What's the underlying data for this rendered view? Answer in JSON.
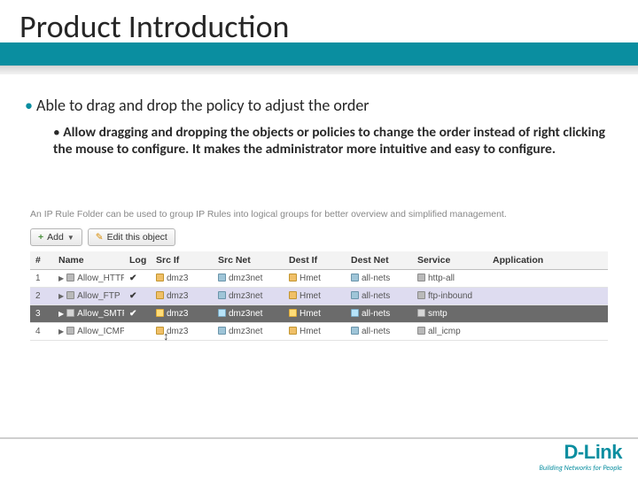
{
  "title": "Product Introduction",
  "bullets": {
    "l1": "Able to drag and drop the policy to adjust the order",
    "l2": "Allow dragging and dropping the objects or policies to change the order instead of right clicking the mouse to configure. It makes the administrator more intuitive and easy to configure."
  },
  "embed": {
    "desc": "An IP Rule Folder can be used to group IP Rules into logical groups for better overview and simplified management.",
    "buttons": {
      "add": "Add",
      "edit": "Edit this object"
    },
    "columns": {
      "idx": "#",
      "name": "Name",
      "log": "Log",
      "srcif": "Src If",
      "srcnet": "Src Net",
      "destif": "Dest If",
      "destnet": "Dest Net",
      "service": "Service",
      "application": "Application"
    },
    "rows": [
      {
        "idx": "1",
        "name": "Allow_HTTP",
        "log": "✔",
        "srcif": "dmz3",
        "srcnet": "dmz3net",
        "destif": "Hmet",
        "destnet": "all-nets",
        "service": "http-all",
        "application": "",
        "state": "normal"
      },
      {
        "idx": "2",
        "name": "Allow_FTP",
        "log": "✔",
        "srcif": "dmz3",
        "srcnet": "dmz3net",
        "destif": "Hmet",
        "destnet": "all-nets",
        "service": "ftp-inbound",
        "application": "",
        "state": "drag-target"
      },
      {
        "idx": "3",
        "name": "Allow_SMTP",
        "log": "✔",
        "srcif": "dmz3",
        "srcnet": "dmz3net",
        "destif": "Hmet",
        "destnet": "all-nets",
        "service": "smtp",
        "application": "",
        "state": "selected"
      },
      {
        "idx": "4",
        "name": "Allow_ICMP",
        "log": "",
        "srcif": "dmz3",
        "srcnet": "dmz3net",
        "destif": "Hmet",
        "destnet": "all-nets",
        "service": "all_icmp",
        "application": "",
        "state": "normal"
      }
    ]
  },
  "logo": {
    "brand": "D-Link",
    "tagline": "Building Networks for People"
  }
}
